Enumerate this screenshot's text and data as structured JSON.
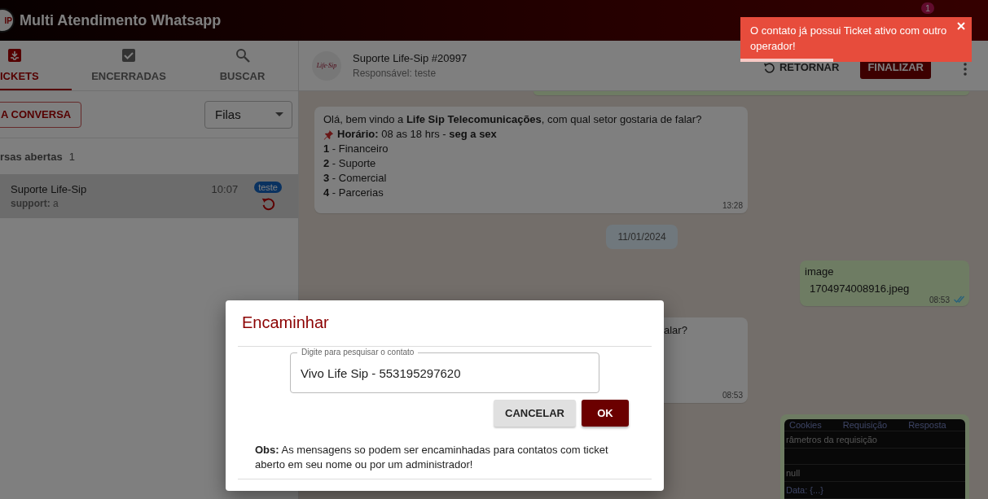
{
  "app_bar": {
    "logo_text": "IP",
    "title": "Multi Atendimento Whatsapp",
    "notification_count": "1"
  },
  "tabs": [
    {
      "label": "ICKETS",
      "selected": true
    },
    {
      "label": "ENCERRADAS",
      "selected": false
    },
    {
      "label": "BUSCAR",
      "selected": false
    }
  ],
  "new_conversation_button": "A CONVERSA",
  "queue_select": {
    "value": "Filas"
  },
  "open_section": {
    "label": "rsas abertas",
    "count": "1"
  },
  "tickets": [
    {
      "name": "Suporte Life-Sip",
      "preview": "**support:** a",
      "time": "10:07",
      "tag": "teste",
      "selected": true
    }
  ],
  "chat_header": {
    "avatar_text": "Life·Sip",
    "title": "Suporte Life-Sip #20997",
    "subtitle": "Responsável: teste",
    "return_button": "RETORNAR",
    "finish_button": "FINALIZAR"
  },
  "messages": [
    {
      "kind": "outgoing_cut"
    },
    {
      "kind": "incoming",
      "lines": [
        {
          "text": "Olá, bem vindo a **Life Sip Telecomunicações**, com qual setor gostaria de falar?",
          "pin": false
        },
        {
          "text": "**Horário:** 08 as 18 hrs - **seg a sex**",
          "pin": true
        },
        {
          "text": "**1** - Financeiro",
          "pin": false
        },
        {
          "text": "**2** - Suporte",
          "pin": false
        },
        {
          "text": "**3** - Comercial",
          "pin": false
        },
        {
          "text": "**4** - Parcerias",
          "pin": false
        }
      ],
      "time": "13:28"
    },
    {
      "kind": "date",
      "text": "11/01/2024"
    },
    {
      "kind": "image",
      "caption": "image",
      "file": "1704974008916.jpeg",
      "time": "08:53",
      "read": true
    },
    {
      "kind": "incoming_partial",
      "lines": [
        {
          "text": "alar?",
          "pin": false
        }
      ],
      "time": "08:53"
    },
    {
      "kind": "screenshot",
      "tabs": [
        "Cookies",
        "Requisição",
        "Resposta"
      ],
      "rows": [
        "râmetros da requisição",
        "",
        "null",
        "Data: {...}"
      ]
    }
  ],
  "dialog": {
    "title": "Encaminhar",
    "field_label": "Digite para pesquisar o contato",
    "field_value": "Vivo Life Sip - 553195297620",
    "cancel_button": "CANCELAR",
    "ok_button": "OK",
    "note": "**Obs:** As mensagens so podem ser encaminhadas para contatos com ticket aberto em seu nome ou por um administrador!"
  },
  "toast": {
    "message": "O contato já possui Ticket ativo com outro operador!",
    "level": 0.4
  }
}
